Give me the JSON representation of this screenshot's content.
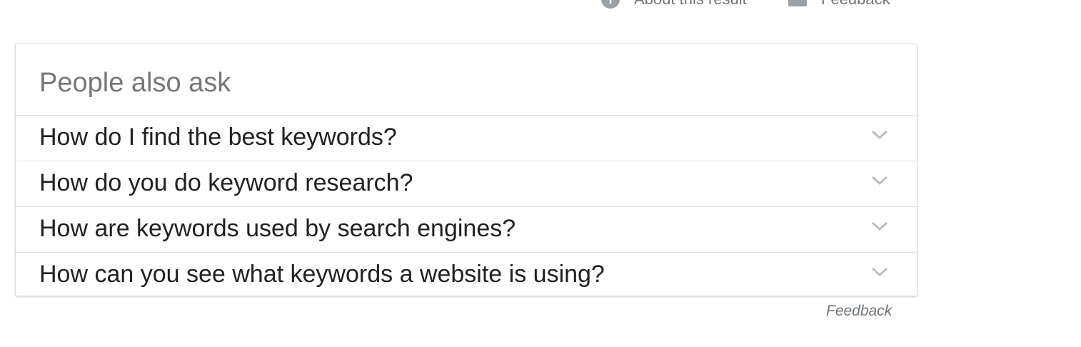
{
  "header": {
    "about_label": "About this result",
    "feedback_label": "Feedback",
    "about_icon": "info-icon",
    "feedback_icon": "feedback-icon"
  },
  "paa": {
    "title": "People also ask",
    "questions": [
      {
        "text": "How do I find the best keywords?",
        "icon": "chevron-down-icon"
      },
      {
        "text": "How do you do keyword research?",
        "icon": "chevron-down-icon"
      },
      {
        "text": "How are keywords used by search engines?",
        "icon": "chevron-down-icon"
      },
      {
        "text": "How can you see what keywords a website is using?",
        "icon": "chevron-down-icon"
      }
    ],
    "feedback_label": "Feedback"
  },
  "colors": {
    "title": "#777777",
    "question_text": "#202124",
    "muted": "#70757a",
    "chevron": "#bdbdbd",
    "divider": "#e0e0e0"
  }
}
